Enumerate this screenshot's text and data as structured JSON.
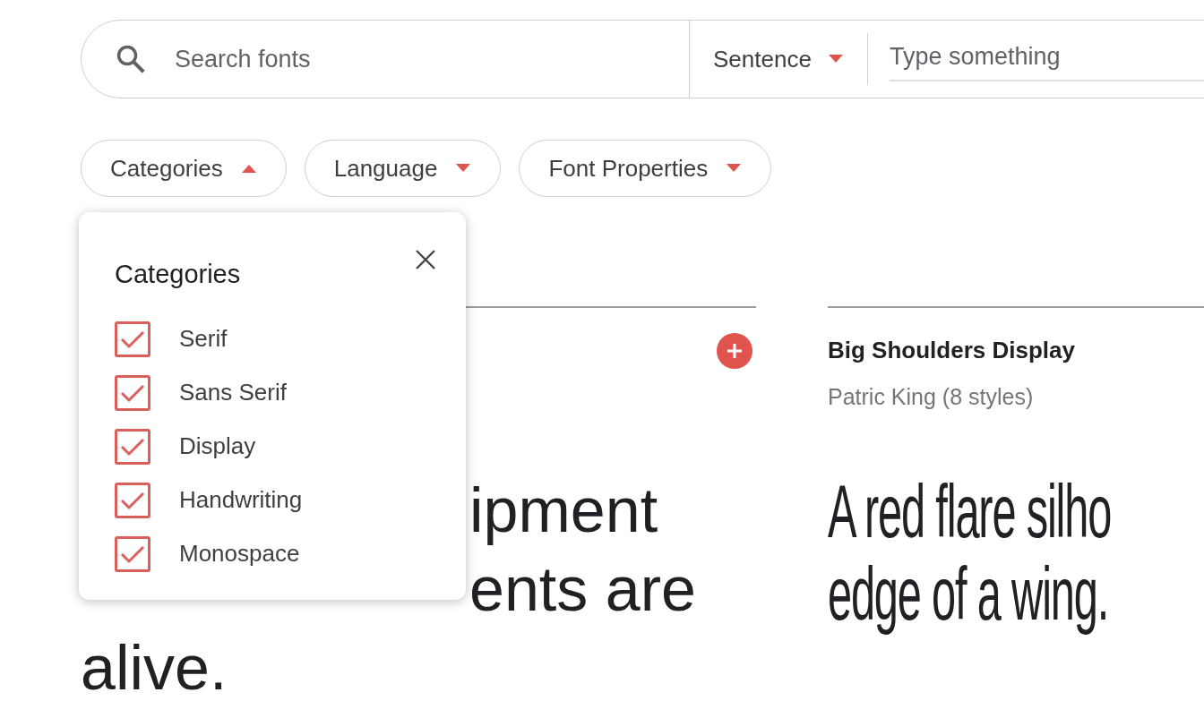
{
  "search": {
    "placeholder": "Search fonts"
  },
  "preview_mode": {
    "label": "Sentence"
  },
  "preview_text": {
    "placeholder": "Type something"
  },
  "filters": [
    {
      "label": "Categories",
      "expanded": true
    },
    {
      "label": "Language",
      "expanded": false
    },
    {
      "label": "Font Properties",
      "expanded": false
    }
  ],
  "categories_popup": {
    "title": "Categories",
    "options": [
      {
        "label": "Serif",
        "checked": true
      },
      {
        "label": "Sans Serif",
        "checked": true
      },
      {
        "label": "Display",
        "checked": true
      },
      {
        "label": "Handwriting",
        "checked": true
      },
      {
        "label": "Monospace",
        "checked": true
      }
    ]
  },
  "font_cards": [
    {
      "sample_lines": [
        "ipment",
        "ents are",
        "alive."
      ]
    },
    {
      "name": "Big Shoulders Display",
      "designer": "Patric King (8 styles)",
      "sample_lines": [
        "A red flare silho",
        "edge of a wing."
      ]
    }
  ]
}
